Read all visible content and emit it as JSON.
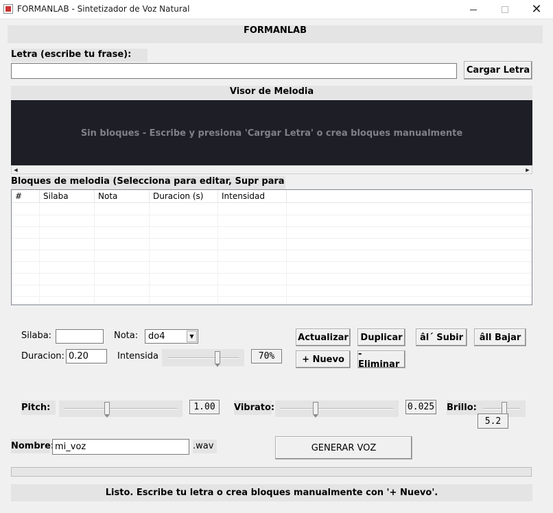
{
  "window": {
    "title": "FORMANLAB - Sintetizador de Voz Natural",
    "minimize_glyph": "",
    "close_glyph": "✕"
  },
  "header": {
    "title": "FORMANLAB"
  },
  "lyrics": {
    "label": "Letra (escribe tu frase):",
    "value": "",
    "load_button": "Cargar Letra"
  },
  "viewer": {
    "title": "Visor de Melodia",
    "empty_message": "Sin bloques - Escribe y presiona 'Cargar Letra' o crea bloques manualmente",
    "scroll_left": "◀",
    "scroll_right": "▶"
  },
  "blocks": {
    "label": "Bloques de melodia (Selecciona para editar, Supr para",
    "columns": [
      "#",
      "Silaba",
      "Nota",
      "Duracion (s)",
      "Intensidad"
    ],
    "rows": []
  },
  "editor": {
    "syllable_label": "Silaba:",
    "syllable_value": "",
    "note_label": "Nota:",
    "note_value": "do4",
    "note_arrow": "▼",
    "duration_label": "Duracion:",
    "duration_value": "0.20",
    "intensity_label": "Intensida",
    "intensity_value": "70%",
    "intensity_level": 0.7,
    "buttons": {
      "update": "Actualizar",
      "duplicate": "Duplicar",
      "up": "âl´ Subir",
      "down": "âll Bajar",
      "new": "+ Nuevo",
      "delete": "- Eliminar"
    }
  },
  "voice": {
    "pitch_label": "Pitch:",
    "pitch_value": "1.00",
    "pitch_level": 0.38,
    "vibrato_label": "Vibrato:",
    "vibrato_value": "0.025",
    "vibrato_level": 0.31,
    "brightness_label": "Brillo:",
    "brightness_value": "5.2",
    "brightness_level": 0.58
  },
  "output": {
    "name_label": "Nombre:",
    "name_value": "mi_voz",
    "extension": ".wav",
    "generate_button": "GENERAR VOZ",
    "progress": 0
  },
  "status": {
    "message": "Listo. Escribe tu letra o crea bloques manualmente con '+ Nuevo'."
  }
}
